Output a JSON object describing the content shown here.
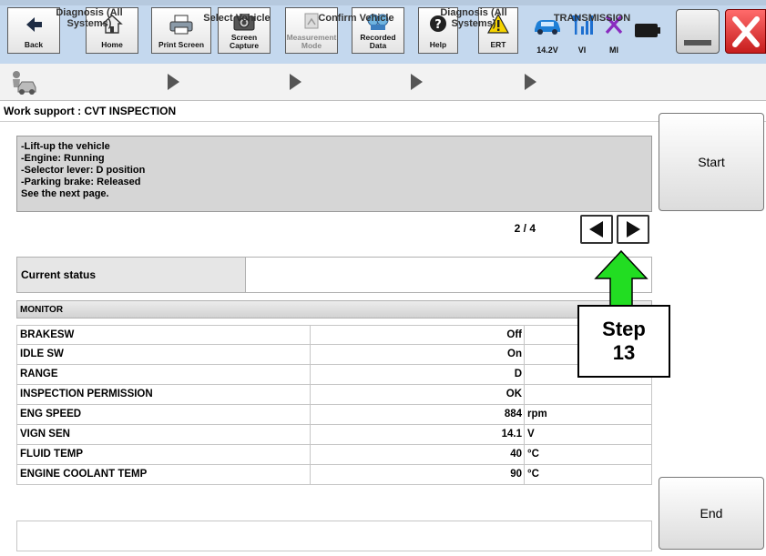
{
  "toolbar": {
    "back_label": "Back",
    "home_label": "Home",
    "print_label": "Print Screen",
    "capture_label_1": "Screen",
    "capture_label_2": "Capture",
    "measure_label_1": "Measurement",
    "measure_label_2": "Mode",
    "recorded_label_1": "Recorded",
    "recorded_label_2": "Data",
    "help_label": "Help",
    "ert_label": "ERT",
    "voltage": "14.2V",
    "vi_label": "VI",
    "mi_label": "MI",
    "colors": {
      "car": "#1e7fd6",
      "signal": "#1d6fd0",
      "close": "#d72828",
      "mi_x": "#8a2bbf"
    }
  },
  "breadcrumb": {
    "items": [
      "Diagnosis (All Systems)",
      "Select Vehicle",
      "Confirm Vehicle",
      "Diagnosis (All Systems)",
      "TRANSMISSION"
    ]
  },
  "work_support": {
    "title": "Work support : CVT INSPECTION"
  },
  "instructions": {
    "lines": [
      "-Lift-up the vehicle",
      "-Engine: Running",
      "-Selector lever: D position",
      "-Parking brake: Released",
      "See the next page."
    ]
  },
  "buttons": {
    "start": "Start",
    "end": "End"
  },
  "pagination": {
    "indicator": "2 / 4"
  },
  "status": {
    "label": "Current status",
    "value": ""
  },
  "monitor": {
    "header": "MONITOR",
    "rows": [
      {
        "name": "BRAKESW",
        "value": "Off",
        "unit": ""
      },
      {
        "name": "IDLE SW",
        "value": "On",
        "unit": ""
      },
      {
        "name": "RANGE",
        "value": "D",
        "unit": ""
      },
      {
        "name": "INSPECTION PERMISSION",
        "value": "OK",
        "unit": ""
      },
      {
        "name": "ENG SPEED",
        "value": "884",
        "unit": "rpm"
      },
      {
        "name": "VIGN SEN",
        "value": "14.1",
        "unit": "V"
      },
      {
        "name": "FLUID TEMP",
        "value": "40",
        "unit": "°C"
      },
      {
        "name": "ENGINE COOLANT TEMP",
        "value": "90",
        "unit": "°C"
      }
    ]
  },
  "callout": {
    "line1": "Step",
    "line2": "13",
    "arrow_color": "#22dd22"
  }
}
